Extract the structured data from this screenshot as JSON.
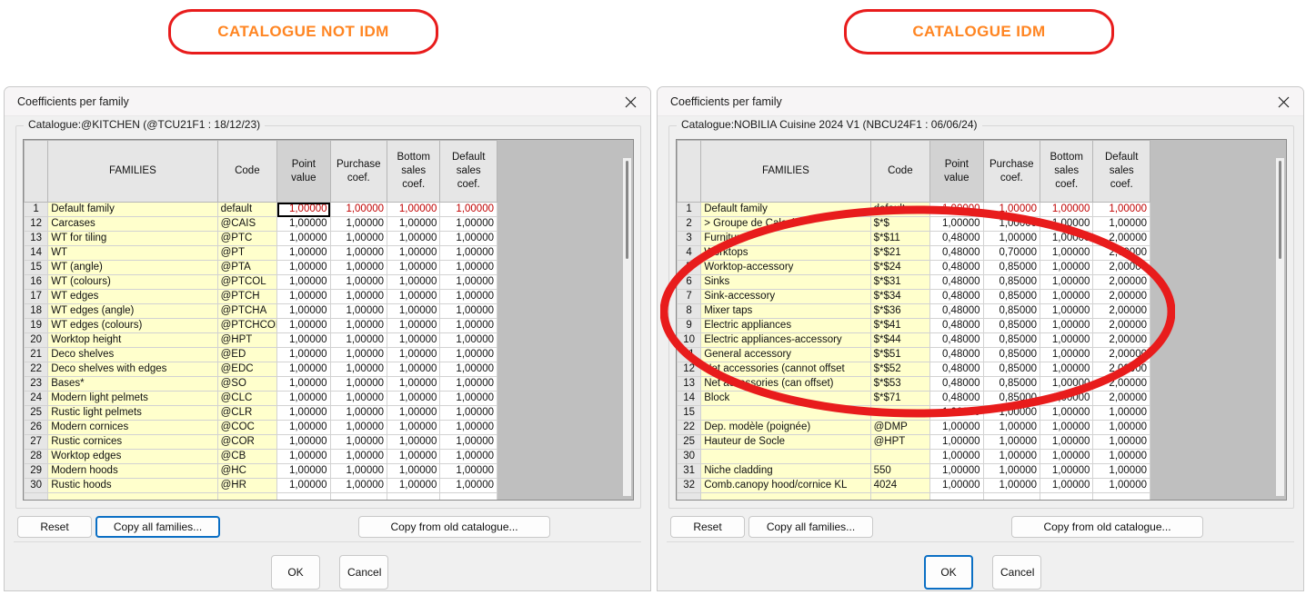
{
  "banners": {
    "left": "CATALOGUE NOT IDM",
    "right": "CATALOGUE IDM"
  },
  "dialog_title": "Coefficients per family",
  "close_icon": "close-icon",
  "columns": [
    "",
    "FAMILIES",
    "Code",
    "Point value",
    "Purchase coef.",
    "Bottom sales coef.",
    "Default sales coef."
  ],
  "column_headers": {
    "rownum": "",
    "families": "FAMILIES",
    "code": "Code",
    "point_value": "Point\nvalue",
    "point_value_l1": "Point",
    "point_value_l2": "value",
    "purchase_l1": "Purchase",
    "purchase_l2": "coef.",
    "bottom_l1": "Bottom",
    "bottom_l2": "sales",
    "bottom_l3": "coef.",
    "default_l1": "Default",
    "default_l2": "sales",
    "default_l3": "coef."
  },
  "buttons": {
    "reset": "Reset",
    "copy_all_families": "Copy all families...",
    "copy_from_old_catalogue": "Copy from old catalogue...",
    "ok": "OK",
    "cancel": "Cancel"
  },
  "left_panel": {
    "catalogue_label": "Catalogue:@KITCHEN (@TCU21F1 : 18/12/23)",
    "focused_button": "copy_all_families",
    "rows": [
      {
        "n": "1",
        "family": "Default family",
        "code": "default",
        "point": "1,00000",
        "purchase": "1,00000",
        "bottom": "1,00000",
        "dflt": "1,00000"
      },
      {
        "n": "12",
        "family": "Carcases",
        "code": "@CAIS",
        "point": "1,00000",
        "purchase": "1,00000",
        "bottom": "1,00000",
        "dflt": "1,00000"
      },
      {
        "n": "13",
        "family": "WT for tiling",
        "code": "@PTC",
        "point": "1,00000",
        "purchase": "1,00000",
        "bottom": "1,00000",
        "dflt": "1,00000"
      },
      {
        "n": "14",
        "family": "WT",
        "code": "@PT",
        "point": "1,00000",
        "purchase": "1,00000",
        "bottom": "1,00000",
        "dflt": "1,00000"
      },
      {
        "n": "15",
        "family": "WT (angle)",
        "code": "@PTA",
        "point": "1,00000",
        "purchase": "1,00000",
        "bottom": "1,00000",
        "dflt": "1,00000"
      },
      {
        "n": "16",
        "family": "WT (colours)",
        "code": "@PTCOL",
        "point": "1,00000",
        "purchase": "1,00000",
        "bottom": "1,00000",
        "dflt": "1,00000"
      },
      {
        "n": "17",
        "family": "WT edges",
        "code": "@PTCH",
        "point": "1,00000",
        "purchase": "1,00000",
        "bottom": "1,00000",
        "dflt": "1,00000"
      },
      {
        "n": "18",
        "family": "WT edges (angle)",
        "code": "@PTCHA",
        "point": "1,00000",
        "purchase": "1,00000",
        "bottom": "1,00000",
        "dflt": "1,00000"
      },
      {
        "n": "19",
        "family": "WT edges (colours)",
        "code": "@PTCHCOL",
        "point": "1,00000",
        "purchase": "1,00000",
        "bottom": "1,00000",
        "dflt": "1,00000"
      },
      {
        "n": "20",
        "family": "Worktop height",
        "code": "@HPT",
        "point": "1,00000",
        "purchase": "1,00000",
        "bottom": "1,00000",
        "dflt": "1,00000"
      },
      {
        "n": "21",
        "family": "Deco shelves",
        "code": "@ED",
        "point": "1,00000",
        "purchase": "1,00000",
        "bottom": "1,00000",
        "dflt": "1,00000"
      },
      {
        "n": "22",
        "family": "Deco shelves with edges",
        "code": "@EDC",
        "point": "1,00000",
        "purchase": "1,00000",
        "bottom": "1,00000",
        "dflt": "1,00000"
      },
      {
        "n": "23",
        "family": "Bases*",
        "code": "@SO",
        "point": "1,00000",
        "purchase": "1,00000",
        "bottom": "1,00000",
        "dflt": "1,00000"
      },
      {
        "n": "24",
        "family": "Modern light pelmets",
        "code": "@CLC",
        "point": "1,00000",
        "purchase": "1,00000",
        "bottom": "1,00000",
        "dflt": "1,00000"
      },
      {
        "n": "25",
        "family": "Rustic light pelmets",
        "code": "@CLR",
        "point": "1,00000",
        "purchase": "1,00000",
        "bottom": "1,00000",
        "dflt": "1,00000"
      },
      {
        "n": "26",
        "family": "Modern cornices",
        "code": "@COC",
        "point": "1,00000",
        "purchase": "1,00000",
        "bottom": "1,00000",
        "dflt": "1,00000"
      },
      {
        "n": "27",
        "family": "Rustic cornices",
        "code": "@COR",
        "point": "1,00000",
        "purchase": "1,00000",
        "bottom": "1,00000",
        "dflt": "1,00000"
      },
      {
        "n": "28",
        "family": "Worktop edges",
        "code": "@CB",
        "point": "1,00000",
        "purchase": "1,00000",
        "bottom": "1,00000",
        "dflt": "1,00000"
      },
      {
        "n": "29",
        "family": "Modern hoods",
        "code": "@HC",
        "point": "1,00000",
        "purchase": "1,00000",
        "bottom": "1,00000",
        "dflt": "1,00000"
      },
      {
        "n": "30",
        "family": "Rustic hoods",
        "code": "@HR",
        "point": "1,00000",
        "purchase": "1,00000",
        "bottom": "1,00000",
        "dflt": "1,00000"
      },
      {
        "n": "",
        "family": "",
        "code": "",
        "point": "",
        "purchase": "",
        "bottom": "",
        "dflt": ""
      }
    ]
  },
  "right_panel": {
    "catalogue_label": "Catalogue:NOBILIA Cuisine 2024 V1 (NBCU24F1 : 06/06/24)",
    "focused_button": "ok",
    "annotation": "red-oval-highlight",
    "annotation_color": "#e81c1c",
    "rows": [
      {
        "n": "1",
        "family": "Default family",
        "code": "default",
        "point": "1,00000",
        "purchase": "1,00000",
        "bottom": "1,00000",
        "dflt": "1,00000"
      },
      {
        "n": "2",
        "family": "> Groupe de Calcul",
        "code": "$*$",
        "point": "1,00000",
        "purchase": "1,00000",
        "bottom": "1,00000",
        "dflt": "1,00000"
      },
      {
        "n": "3",
        "family": "Furniture",
        "code": "$*$11",
        "point": "0,48000",
        "purchase": "1,00000",
        "bottom": "1,00000",
        "dflt": "2,00000"
      },
      {
        "n": "4",
        "family": "Worktops",
        "code": "$*$21",
        "point": "0,48000",
        "purchase": "0,70000",
        "bottom": "1,00000",
        "dflt": "2,00000"
      },
      {
        "n": "5",
        "family": "Worktop-accessory",
        "code": "$*$24",
        "point": "0,48000",
        "purchase": "0,85000",
        "bottom": "1,00000",
        "dflt": "2,00000"
      },
      {
        "n": "6",
        "family": "Sinks",
        "code": "$*$31",
        "point": "0,48000",
        "purchase": "0,85000",
        "bottom": "1,00000",
        "dflt": "2,00000"
      },
      {
        "n": "7",
        "family": "Sink-accessory",
        "code": "$*$34",
        "point": "0,48000",
        "purchase": "0,85000",
        "bottom": "1,00000",
        "dflt": "2,00000"
      },
      {
        "n": "8",
        "family": "Mixer taps",
        "code": "$*$36",
        "point": "0,48000",
        "purchase": "0,85000",
        "bottom": "1,00000",
        "dflt": "2,00000"
      },
      {
        "n": "9",
        "family": "Electric appliances",
        "code": "$*$41",
        "point": "0,48000",
        "purchase": "0,85000",
        "bottom": "1,00000",
        "dflt": "2,00000"
      },
      {
        "n": "10",
        "family": "Electric appliances-accessory",
        "code": "$*$44",
        "point": "0,48000",
        "purchase": "0,85000",
        "bottom": "1,00000",
        "dflt": "2,00000"
      },
      {
        "n": "11",
        "family": "General accessory",
        "code": "$*$51",
        "point": "0,48000",
        "purchase": "0,85000",
        "bottom": "1,00000",
        "dflt": "2,00000"
      },
      {
        "n": "12",
        "family": "Net accessories (cannot offset",
        "code": "$*$52",
        "point": "0,48000",
        "purchase": "0,85000",
        "bottom": "1,00000",
        "dflt": "2,00000"
      },
      {
        "n": "13",
        "family": "Net accessories (can offset)",
        "code": "$*$53",
        "point": "0,48000",
        "purchase": "0,85000",
        "bottom": "1,00000",
        "dflt": "2,00000"
      },
      {
        "n": "14",
        "family": "Block",
        "code": "$*$71",
        "point": "0,48000",
        "purchase": "0,85000",
        "bottom": "1,00000",
        "dflt": "2,00000"
      },
      {
        "n": "15",
        "family": "",
        "code": "",
        "point": "1,00000",
        "purchase": "1,00000",
        "bottom": "1,00000",
        "dflt": "1,00000"
      },
      {
        "n": "22",
        "family": "Dep. modèle (poignée)",
        "code": "@DMP",
        "point": "1,00000",
        "purchase": "1,00000",
        "bottom": "1,00000",
        "dflt": "1,00000"
      },
      {
        "n": "25",
        "family": "Hauteur de Socle",
        "code": "@HPT",
        "point": "1,00000",
        "purchase": "1,00000",
        "bottom": "1,00000",
        "dflt": "1,00000"
      },
      {
        "n": "30",
        "family": "",
        "code": "",
        "point": "1,00000",
        "purchase": "1,00000",
        "bottom": "1,00000",
        "dflt": "1,00000"
      },
      {
        "n": "31",
        "family": "Niche cladding",
        "code": "550",
        "point": "1,00000",
        "purchase": "1,00000",
        "bottom": "1,00000",
        "dflt": "1,00000"
      },
      {
        "n": "32",
        "family": "Comb.canopy hood/cornice KL",
        "code": "4024",
        "point": "1,00000",
        "purchase": "1,00000",
        "bottom": "1,00000",
        "dflt": "1,00000"
      },
      {
        "n": "",
        "family": "",
        "code": "",
        "point": "",
        "purchase": "",
        "bottom": "",
        "dflt": ""
      }
    ]
  }
}
